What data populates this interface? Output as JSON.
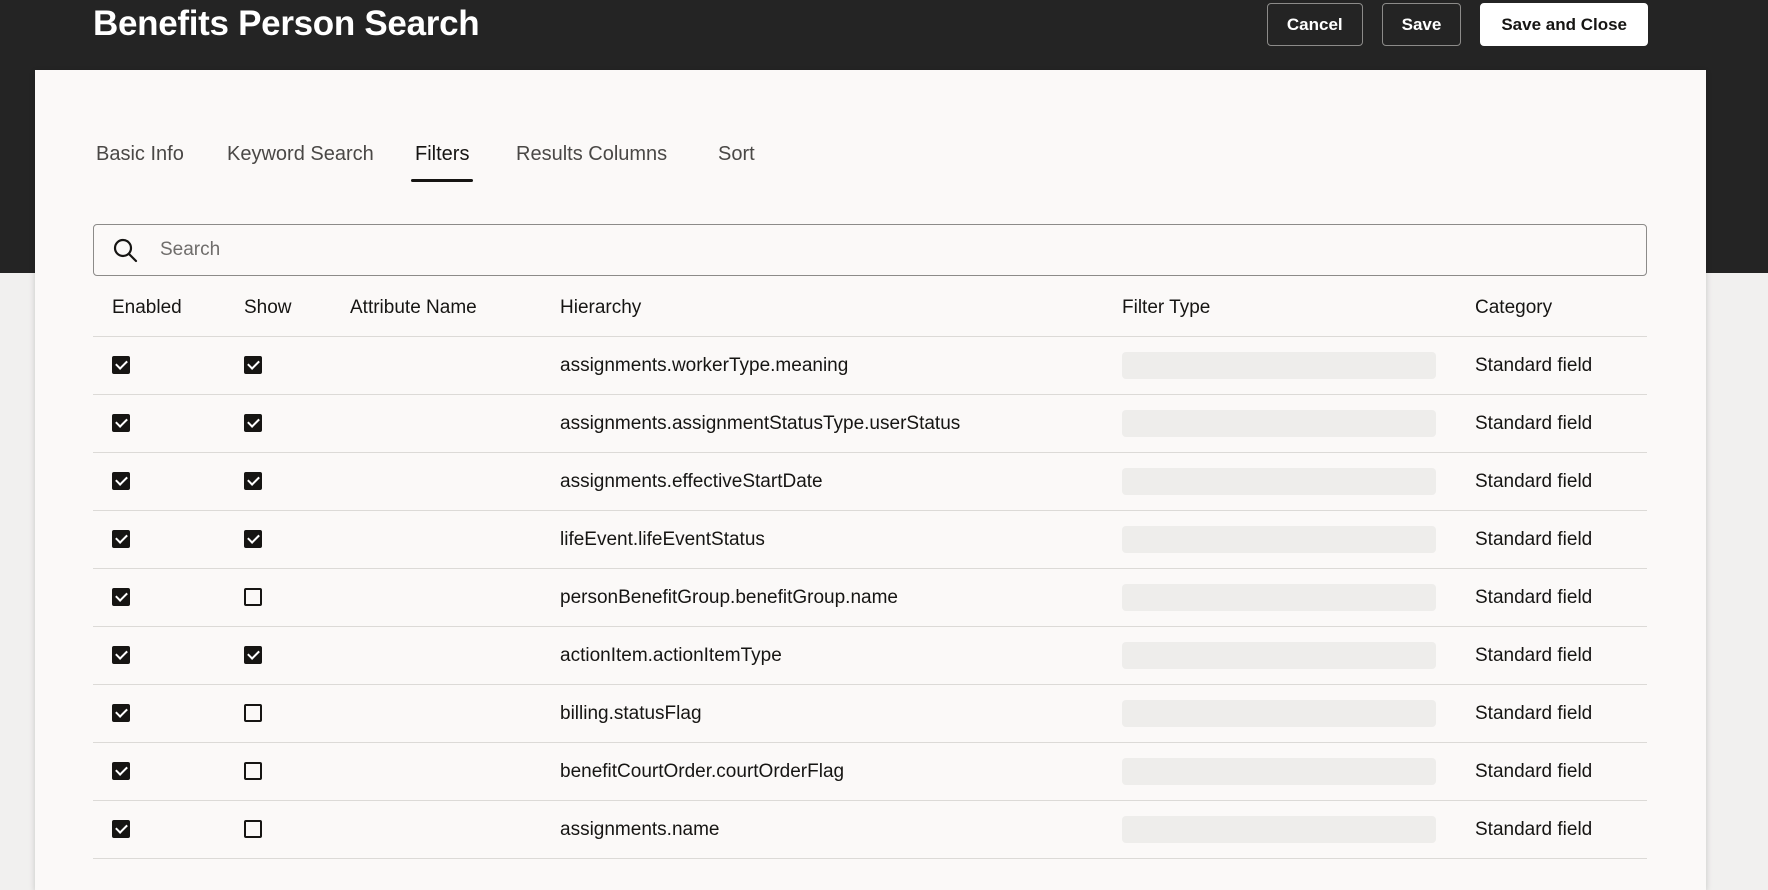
{
  "header": {
    "title": "Benefits Person Search",
    "cancel_label": "Cancel",
    "save_label": "Save",
    "save_close_label": "Save and Close"
  },
  "tabs": [
    {
      "label": "Basic Info",
      "active": false
    },
    {
      "label": "Keyword Search",
      "active": false
    },
    {
      "label": "Filters",
      "active": true
    },
    {
      "label": "Results Columns",
      "active": false
    },
    {
      "label": "Sort",
      "active": false
    }
  ],
  "search": {
    "placeholder": "Search",
    "value": "",
    "icon": "search-icon"
  },
  "table": {
    "columns": {
      "enabled": "Enabled",
      "show": "Show",
      "attribute_name": "Attribute Name",
      "hierarchy": "Hierarchy",
      "filter_type": "Filter Type",
      "category": "Category"
    },
    "rows": [
      {
        "enabled": true,
        "show": true,
        "attribute_name": "",
        "hierarchy": "assignments.workerType.meaning",
        "filter_type": "",
        "category": "Standard field"
      },
      {
        "enabled": true,
        "show": true,
        "attribute_name": "",
        "hierarchy": "assignments.assignmentStatusType.userStatus",
        "filter_type": "",
        "category": "Standard field"
      },
      {
        "enabled": true,
        "show": true,
        "attribute_name": "",
        "hierarchy": "assignments.effectiveStartDate",
        "filter_type": "",
        "category": "Standard field"
      },
      {
        "enabled": true,
        "show": true,
        "attribute_name": "",
        "hierarchy": "lifeEvent.lifeEventStatus",
        "filter_type": "",
        "category": "Standard field"
      },
      {
        "enabled": true,
        "show": false,
        "attribute_name": "",
        "hierarchy": "personBenefitGroup.benefitGroup.name",
        "filter_type": "",
        "category": "Standard field"
      },
      {
        "enabled": true,
        "show": true,
        "attribute_name": "",
        "hierarchy": "actionItem.actionItemType",
        "filter_type": "",
        "category": "Standard field"
      },
      {
        "enabled": true,
        "show": false,
        "attribute_name": "",
        "hierarchy": "billing.statusFlag",
        "filter_type": "",
        "category": "Standard field"
      },
      {
        "enabled": true,
        "show": false,
        "attribute_name": "",
        "hierarchy": "benefitCourtOrder.courtOrderFlag",
        "filter_type": "",
        "category": "Standard field"
      },
      {
        "enabled": true,
        "show": false,
        "attribute_name": "",
        "hierarchy": "assignments.name",
        "filter_type": "",
        "category": "Standard field"
      }
    ]
  },
  "colors": {
    "header_bg": "#242424",
    "panel_bg": "#fbf9f8",
    "page_bg": "#f1f0ef",
    "text": "#161513",
    "divider": "#dcdad7"
  }
}
